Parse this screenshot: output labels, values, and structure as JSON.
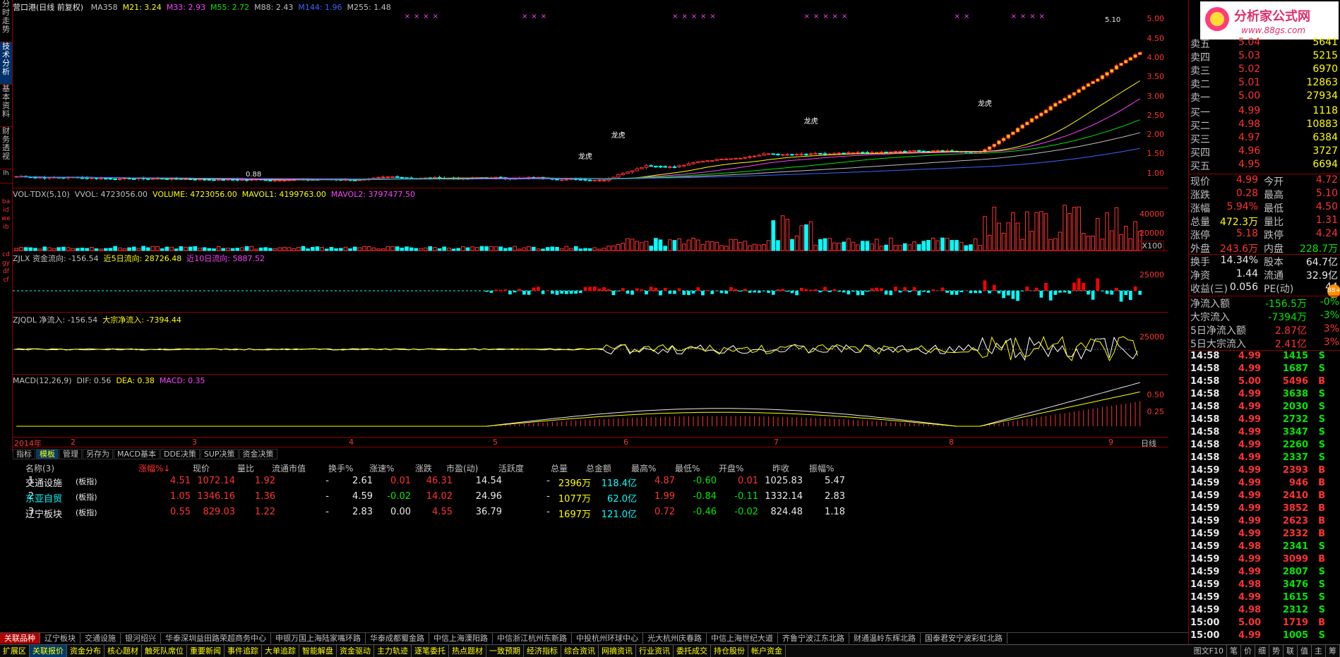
{
  "side_tabs": [
    "分时走势",
    "技术分析",
    "基本资料",
    "财务透视"
  ],
  "main": {
    "title": "营口港(日线 前复权)",
    "ma_labels": [
      {
        "text": "MA358",
        "color": "#c0c0c0"
      },
      {
        "text": "M21: 3.24",
        "color": "#ffff00"
      },
      {
        "text": "M33: 2.93",
        "color": "#ff40ff"
      },
      {
        "text": "M55: 2.72",
        "color": "#00e600"
      },
      {
        "text": "M88: 2.43",
        "color": "#c0c0c0"
      },
      {
        "text": "M144: 1.96",
        "color": "#3c64ff"
      },
      {
        "text": "M255: 1.48",
        "color": "#c0c0c0"
      }
    ],
    "yticks": [
      "5.00",
      "4.50",
      "4.00",
      "3.50",
      "3.00",
      "2.50",
      "2.00",
      "1.50",
      "1.00"
    ],
    "high_label": "5.10",
    "low_label": "0.88",
    "dragon_label": "龙虎"
  },
  "vol": {
    "labels": [
      {
        "text": "VOL-TDX(5,10)",
        "color": "#c0c0c0"
      },
      {
        "text": "VVOL: 4723056.00",
        "color": "#c0c0c0"
      },
      {
        "text": "VOLUME: 4723056.00",
        "color": "#ffff00"
      },
      {
        "text": "MAVOL1: 4199763.00",
        "color": "#ffff00"
      },
      {
        "text": "MAVOL2: 3797477.50",
        "color": "#ff40ff"
      }
    ],
    "yticks": [
      "40000",
      "20000"
    ],
    "unit": "X100",
    "side": [
      "ba",
      "id",
      "we",
      "ib"
    ]
  },
  "zjlx": {
    "labels": [
      {
        "text": "ZJLX 资金流向: -156.54",
        "color": "#c0c0c0"
      },
      {
        "text": "近5日流向: 28726.48",
        "color": "#ffff00"
      },
      {
        "text": "近10日流向: 5887.52",
        "color": "#ff40ff"
      }
    ],
    "yticks": [
      "25000"
    ],
    "side": [
      "cd",
      "gy",
      "df",
      "cf"
    ]
  },
  "zjqdl": {
    "labels": [
      {
        "text": "ZJQDL 净流入: -156.54",
        "color": "#c0c0c0"
      },
      {
        "text": "大宗净流入: -7394.44",
        "color": "#ffff00"
      }
    ],
    "yticks": [
      "25000"
    ]
  },
  "macd": {
    "labels": [
      {
        "text": "MACD(12,26,9)",
        "color": "#c0c0c0"
      },
      {
        "text": "DIF: 0.56",
        "color": "#c0c0c0"
      },
      {
        "text": "DEA: 0.38",
        "color": "#ffff00"
      },
      {
        "text": "MACD: 0.35",
        "color": "#ff40ff"
      }
    ],
    "yticks": [
      "0.50",
      "0.25"
    ]
  },
  "xaxis": {
    "labels": [
      "2014年",
      "2",
      "3",
      "4",
      "5",
      "6",
      "7",
      "8",
      "9"
    ],
    "period": "日线"
  },
  "toolbar": [
    "指标",
    "模板",
    "管理",
    "另存为",
    "MACD基本",
    "DDE决策",
    "SUP决策",
    "资金决策"
  ],
  "table": {
    "headers": [
      "名称(3)",
      "涨幅%↓",
      "现价",
      "量比",
      "流通市值",
      "换手%",
      "涨速%",
      "涨跌",
      "市盈(动)",
      "活跃度",
      "总量",
      "总金额",
      "最高%",
      "最低%",
      "开盘%",
      "昨收",
      "振幅%"
    ],
    "rows": [
      {
        "idx": "1",
        "name": "交通设施",
        "tag": "(板指)",
        "chg": "4.51",
        "price": "1072.14",
        "lb": "1.92",
        "mv": "-",
        "hs": "2.61",
        "zs": "0.01",
        "zd": "46.31",
        "pe": "14.54",
        "hy": "-",
        "vol": "2396万",
        "amt": "118.4亿",
        "high": "4.87",
        "low": "-0.60",
        "open": "0.01",
        "prev": "1025.83",
        "amp": "5.47"
      },
      {
        "idx": "2",
        "name": "东亚自贸",
        "tag": "(板指)",
        "chg": "1.05",
        "price": "1346.16",
        "lb": "1.36",
        "mv": "-",
        "hs": "4.59",
        "zs": "-0.02",
        "zd": "14.02",
        "pe": "24.96",
        "hy": "-",
        "vol": "1077万",
        "amt": "62.0亿",
        "high": "1.99",
        "low": "-0.84",
        "open": "-0.11",
        "prev": "1332.14",
        "amp": "2.83"
      },
      {
        "idx": "3",
        "name": "辽宁板块",
        "tag": "(板指)",
        "chg": "0.55",
        "price": "829.03",
        "lb": "1.22",
        "mv": "-",
        "hs": "2.83",
        "zs": "0.00",
        "zd": "4.55",
        "pe": "36.79",
        "hy": "-",
        "vol": "1697万",
        "amt": "121.0亿",
        "high": "0.72",
        "low": "-0.46",
        "open": "-0.02",
        "prev": "824.48",
        "amp": "1.18"
      }
    ]
  },
  "logo": {
    "title": "分析家公式网",
    "url": "www.88gs.com"
  },
  "quotes": {
    "sell": [
      {
        "l": "卖五",
        "p": "5.04",
        "v": "5641"
      },
      {
        "l": "卖四",
        "p": "5.03",
        "v": "5215"
      },
      {
        "l": "卖三",
        "p": "5.02",
        "v": "6970"
      },
      {
        "l": "卖二",
        "p": "5.01",
        "v": "12863"
      },
      {
        "l": "卖一",
        "p": "5.00",
        "v": "27934"
      }
    ],
    "buy": [
      {
        "l": "买一",
        "p": "4.99",
        "v": "1118"
      },
      {
        "l": "买二",
        "p": "4.98",
        "v": "10883"
      },
      {
        "l": "买三",
        "p": "4.97",
        "v": "6384"
      },
      {
        "l": "买四",
        "p": "4.96",
        "v": "3727"
      },
      {
        "l": "买五",
        "p": "4.95",
        "v": "6694"
      }
    ],
    "stats": [
      {
        "l1": "现价",
        "v1": "4.99",
        "l2": "今开",
        "v2": "4.72"
      },
      {
        "l1": "涨跌",
        "v1": "0.28",
        "l2": "最高",
        "v2": "5.10"
      },
      {
        "l1": "涨幅",
        "v1": "5.94%",
        "l2": "最低",
        "v2": "4.50"
      },
      {
        "l1": "总量",
        "v1": "472.3万",
        "l2": "量比",
        "v2": "1.31"
      },
      {
        "l1": "涨停",
        "v1": "5.18",
        "l2": "跌停",
        "v2": "4.24"
      },
      {
        "l1": "外盘",
        "v1": "243.6万",
        "l2": "内盘",
        "v2": "228.7万"
      }
    ],
    "stats2": [
      {
        "l1": "换手",
        "v1": "14.34%",
        "l2": "股本",
        "v2": "64.7亿"
      },
      {
        "l1": "净资",
        "v1": "1.44",
        "l2": "流通",
        "v2": "32.9亿"
      },
      {
        "l1": "收益(三)",
        "v1": "0.056",
        "l2": "PE(动)",
        "v2": "44"
      }
    ],
    "flows": [
      {
        "l": "净流入额",
        "v": "-156.5万",
        "p": "-0%"
      },
      {
        "l": "大宗流入",
        "v": "-7394万",
        "p": "-3%"
      },
      {
        "l": "5日净流入额",
        "v": "2.87亿",
        "p": "3%"
      },
      {
        "l": "5日大宗流入",
        "v": "2.41亿",
        "p": "3%"
      }
    ],
    "badge": "88+"
  },
  "ticks": [
    [
      "14:58",
      "4.99",
      "1415",
      "S"
    ],
    [
      "14:58",
      "4.99",
      "1687",
      "S"
    ],
    [
      "14:58",
      "5.00",
      "5496",
      "B"
    ],
    [
      "14:58",
      "4.99",
      "3638",
      "S"
    ],
    [
      "14:58",
      "4.99",
      "2030",
      "S"
    ],
    [
      "14:58",
      "4.99",
      "2732",
      "S"
    ],
    [
      "14:58",
      "4.99",
      "3347",
      "S"
    ],
    [
      "14:58",
      "4.99",
      "2260",
      "S"
    ],
    [
      "14:58",
      "4.99",
      "2337",
      "S"
    ],
    [
      "14:59",
      "4.99",
      "2393",
      "B"
    ],
    [
      "14:59",
      "4.99",
      "946",
      "B"
    ],
    [
      "14:59",
      "4.99",
      "2410",
      "B"
    ],
    [
      "14:59",
      "4.99",
      "3852",
      "B"
    ],
    [
      "14:59",
      "4.99",
      "2623",
      "B"
    ],
    [
      "14:59",
      "4.99",
      "2332",
      "B"
    ],
    [
      "14:59",
      "4.98",
      "2341",
      "S"
    ],
    [
      "14:59",
      "4.99",
      "3099",
      "B"
    ],
    [
      "14:59",
      "4.99",
      "2807",
      "S"
    ],
    [
      "14:59",
      "4.98",
      "3476",
      "S"
    ],
    [
      "14:59",
      "4.99",
      "1615",
      "S"
    ],
    [
      "14:59",
      "4.98",
      "2312",
      "S"
    ],
    [
      "15:00",
      "5.00",
      "1719",
      "B"
    ],
    [
      "15:00",
      "4.99",
      "1005",
      "S"
    ]
  ],
  "bottom_tabs": [
    "关联品种",
    "辽宁板块",
    "交通设施",
    "银河绍兴",
    "华泰深圳益田路荣超商务中心",
    "申银万国上海陆家嘴环路",
    "华泰成都蜀金路",
    "中信上海溧阳路",
    "中信浙江杭州东新路",
    "中投杭州环球中心",
    "光大杭州庆春路",
    "中信上海世纪大道",
    "齐鲁宁波江东北路",
    "财通温岭东辉北路",
    "国泰君安宁波彩虹北路"
  ],
  "status_tabs": [
    "扩展区",
    "关联报价",
    "资金分布",
    "核心题材",
    "触死队席位",
    "重要新闻",
    "事件追踪",
    "大单追踪",
    "智能解盘",
    "资金驱动",
    "主力轨迹",
    "逐笔委托",
    "热点题材",
    "一致预期",
    "经济指标",
    "综合资讯",
    "网摘资讯",
    "行业资讯",
    "委托成交",
    "持仓股份",
    "帐户资金"
  ],
  "status_right": [
    "图文F10",
    "笔",
    "价",
    "细",
    "势",
    "联",
    "值",
    "主",
    "筹"
  ]
}
